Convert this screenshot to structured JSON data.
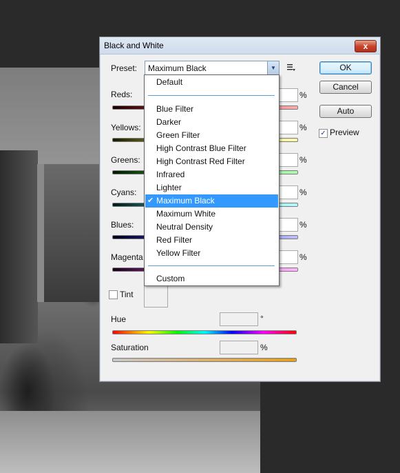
{
  "dialog": {
    "title": "Black and White",
    "close_label": "x"
  },
  "preset": {
    "label": "Preset:",
    "value": "Maximum Black"
  },
  "buttons": {
    "ok": "OK",
    "cancel": "Cancel",
    "auto": "Auto"
  },
  "preview": {
    "label": "Preview",
    "checked": true
  },
  "channels": [
    {
      "label": "Reds:",
      "unit": "%",
      "color": "#c0303a"
    },
    {
      "label": "Yellows:",
      "unit": "%",
      "color": "#c7c23a"
    },
    {
      "label": "Greens:",
      "unit": "%",
      "color": "#3aa83a"
    },
    {
      "label": "Cyans:",
      "unit": "%",
      "color": "#36b5b5"
    },
    {
      "label": "Blues:",
      "unit": "%",
      "color": "#3a3ac8"
    },
    {
      "label": "Magenta",
      "unit": "%",
      "color": "#c03ac0"
    }
  ],
  "tint": {
    "label": "Tint",
    "checked": false,
    "hue_label": "Hue",
    "hue_unit": "°",
    "saturation_label": "Saturation",
    "saturation_unit": "%"
  },
  "dropdown": {
    "items_top": [
      "Default"
    ],
    "items_mid": [
      "Blue Filter",
      "Darker",
      "Green Filter",
      "High Contrast Blue Filter",
      "High Contrast Red Filter",
      "Infrared",
      "Lighter",
      "Maximum Black",
      "Maximum White",
      "Neutral Density",
      "Red Filter",
      "Yellow Filter"
    ],
    "items_bottom": [
      "Custom"
    ],
    "selected": "Maximum Black",
    "check_glyph": "✔"
  }
}
